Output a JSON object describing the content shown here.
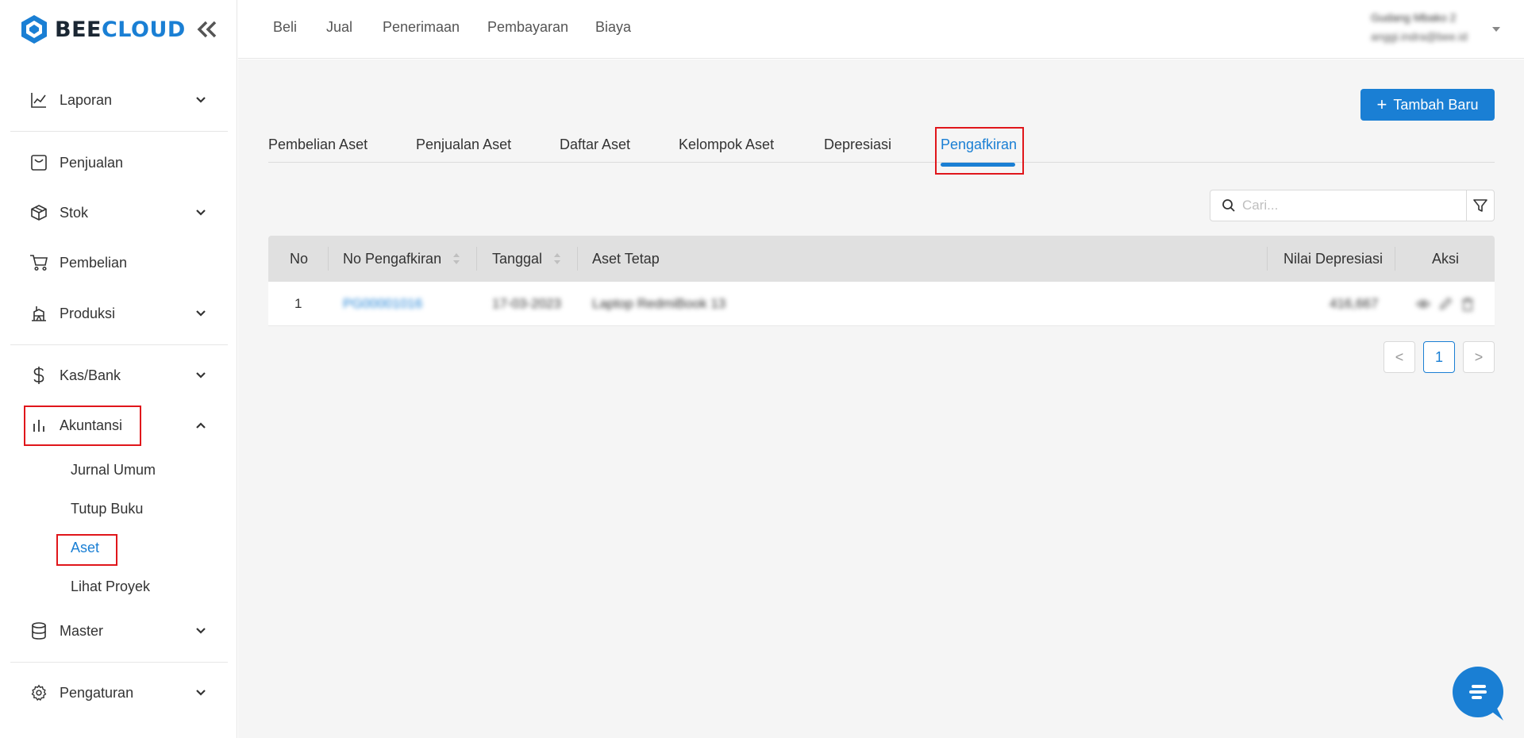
{
  "brand": {
    "bee": "BEE",
    "cloud": "CLOUD"
  },
  "colors": {
    "accent": "#1a7fd4",
    "highlight": "#e0161b"
  },
  "sidebar": {
    "items": [
      {
        "label": "Laporan",
        "icon": "line-chart-icon",
        "expandable": true
      },
      {
        "label": "Penjualan",
        "icon": "receipt-icon",
        "expandable": false
      },
      {
        "label": "Stok",
        "icon": "box-icon",
        "expandable": true
      },
      {
        "label": "Pembelian",
        "icon": "cart-icon",
        "expandable": false
      },
      {
        "label": "Produksi",
        "icon": "factory-icon",
        "expandable": true
      },
      {
        "label": "Kas/Bank",
        "icon": "dollar-icon",
        "expandable": true
      },
      {
        "label": "Akuntansi",
        "icon": "bar-chart-icon",
        "expandable": true,
        "expanded": true
      },
      {
        "label": "Master",
        "icon": "database-icon",
        "expandable": true
      },
      {
        "label": "Pengaturan",
        "icon": "gear-icon",
        "expandable": true
      }
    ],
    "akuntansi_sub": [
      {
        "label": "Jurnal Umum"
      },
      {
        "label": "Tutup Buku"
      },
      {
        "label": "Aset",
        "active": true
      },
      {
        "label": "Lihat Proyek"
      }
    ]
  },
  "topnav": {
    "items": [
      "Beli",
      "Jual",
      "Penerimaan",
      "Pembayaran",
      "Biaya"
    ],
    "user_name": "Gudang Mbako 2",
    "user_email": "anggi.indra@bee.id"
  },
  "main": {
    "add_button": "Tambah Baru",
    "tabs": [
      "Pembelian Aset",
      "Penjualan Aset",
      "Daftar Aset",
      "Kelompok Aset",
      "Depresiasi",
      "Pengafkiran"
    ],
    "active_tab": "Pengafkiran",
    "search_placeholder": "Cari...",
    "table": {
      "headers": [
        "No",
        "No Pengafkiran",
        "Tanggal",
        "Aset Tetap",
        "Nilai Depresiasi",
        "Aksi"
      ],
      "rows": [
        {
          "no": "1",
          "no_pengafkiran": "PG00001016",
          "tanggal": "17-03-2023",
          "aset_tetap": "Laptop RedmiBook 13",
          "nilai_depresiasi": "416,667"
        }
      ]
    },
    "pagination": {
      "current": "1",
      "prev": "<",
      "next": ">"
    }
  }
}
